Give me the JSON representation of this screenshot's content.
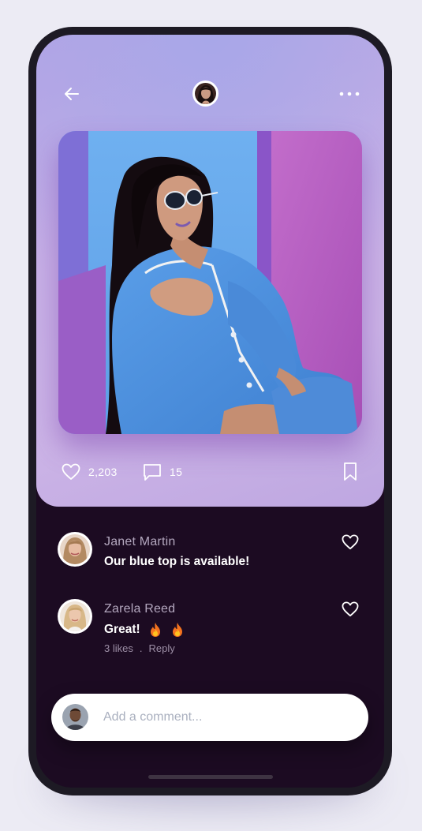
{
  "nav": {
    "back_icon": "arrow-left-icon",
    "more_icon": "more-horizontal-icon"
  },
  "post": {
    "likes": "2,203",
    "comments": "15",
    "like_icon": "heart-icon",
    "comment_icon": "comment-icon",
    "bookmark_icon": "bookmark-icon"
  },
  "comments": [
    {
      "name": "Janet Martin",
      "text": "Our blue top is available!"
    },
    {
      "name": "Zarela Reed",
      "text": "Great!",
      "emoji": [
        "fire-icon",
        "fire-icon"
      ],
      "likes": "3 likes",
      "separator": ".",
      "reply": "Reply"
    }
  ],
  "compose": {
    "placeholder": "Add a comment..."
  },
  "colors": {
    "panel": "#c6b0e6",
    "background_dark": "#1c0b22",
    "photo_blue": "#6aa8ec",
    "photo_magenta": "#b35bbd"
  }
}
